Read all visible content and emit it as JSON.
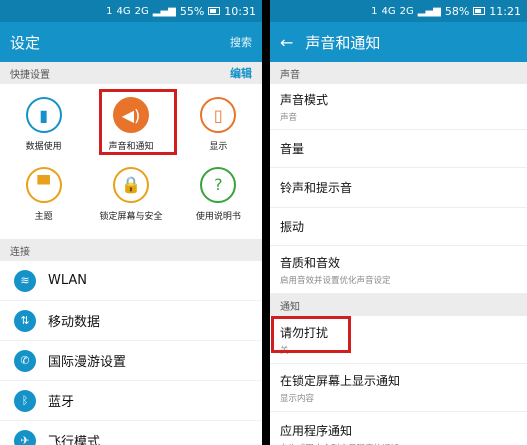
{
  "left": {
    "status": {
      "sim": "1",
      "net1": "4G",
      "net2": "2G",
      "battery": "55%",
      "time": "10:31"
    },
    "header": {
      "title": "设定",
      "search": "搜索"
    },
    "quick": {
      "section": "快捷设置",
      "edit": "编辑",
      "tiles": [
        {
          "label": "数据使用",
          "icon": "bar-chart-icon",
          "glyph": "▮",
          "color": "#1592c8"
        },
        {
          "label": "声音和通知",
          "icon": "speaker-icon",
          "glyph": "◀)",
          "color": "#e8742c",
          "filled": true
        },
        {
          "label": "显示",
          "icon": "display-icon",
          "glyph": "▯",
          "color": "#e8742c"
        },
        {
          "label": "主题",
          "icon": "paintbrush-icon",
          "glyph": "▀",
          "color": "#e8a11a"
        },
        {
          "label": "锁定屏幕与安全",
          "icon": "lock-icon",
          "glyph": "🔒",
          "color": "#e8a11a"
        },
        {
          "label": "使用说明书",
          "icon": "help-book-icon",
          "glyph": "?",
          "color": "#3aa33a"
        }
      ]
    },
    "connect": {
      "section": "连接",
      "items": [
        {
          "label": "WLAN",
          "icon": "wifi-icon",
          "glyph": "≋"
        },
        {
          "label": "移动数据",
          "icon": "mobile-data-icon",
          "glyph": "⇅"
        },
        {
          "label": "国际漫游设置",
          "icon": "roaming-icon",
          "glyph": "✆"
        },
        {
          "label": "蓝牙",
          "icon": "bluetooth-icon",
          "glyph": "ᛒ"
        },
        {
          "label": "飞行模式",
          "icon": "airplane-icon",
          "glyph": "✈"
        }
      ]
    }
  },
  "right": {
    "status": {
      "sim": "1",
      "net1": "4G",
      "net2": "2G",
      "battery": "58%",
      "time": "11:21"
    },
    "header": {
      "title": "声音和通知"
    },
    "sound_section": "声音",
    "sound_items": [
      {
        "title": "声音模式",
        "sub": "声音"
      },
      {
        "title": "音量",
        "sub": ""
      },
      {
        "title": "铃声和提示音",
        "sub": ""
      },
      {
        "title": "振动",
        "sub": ""
      },
      {
        "title": "音质和音效",
        "sub": "启用音效并设置优化声音设定"
      }
    ],
    "notify_section": "通知",
    "notify_items": [
      {
        "title": "请勿打扰",
        "sub": "关"
      },
      {
        "title": "在锁定屏幕上显示通知",
        "sub": "显示内容"
      },
      {
        "title": "应用程序通知",
        "sub": "允许或阻止个别应用程序的通知"
      }
    ]
  },
  "colors": {
    "accent": "#1592c8",
    "highlight": "#d11e1e"
  }
}
